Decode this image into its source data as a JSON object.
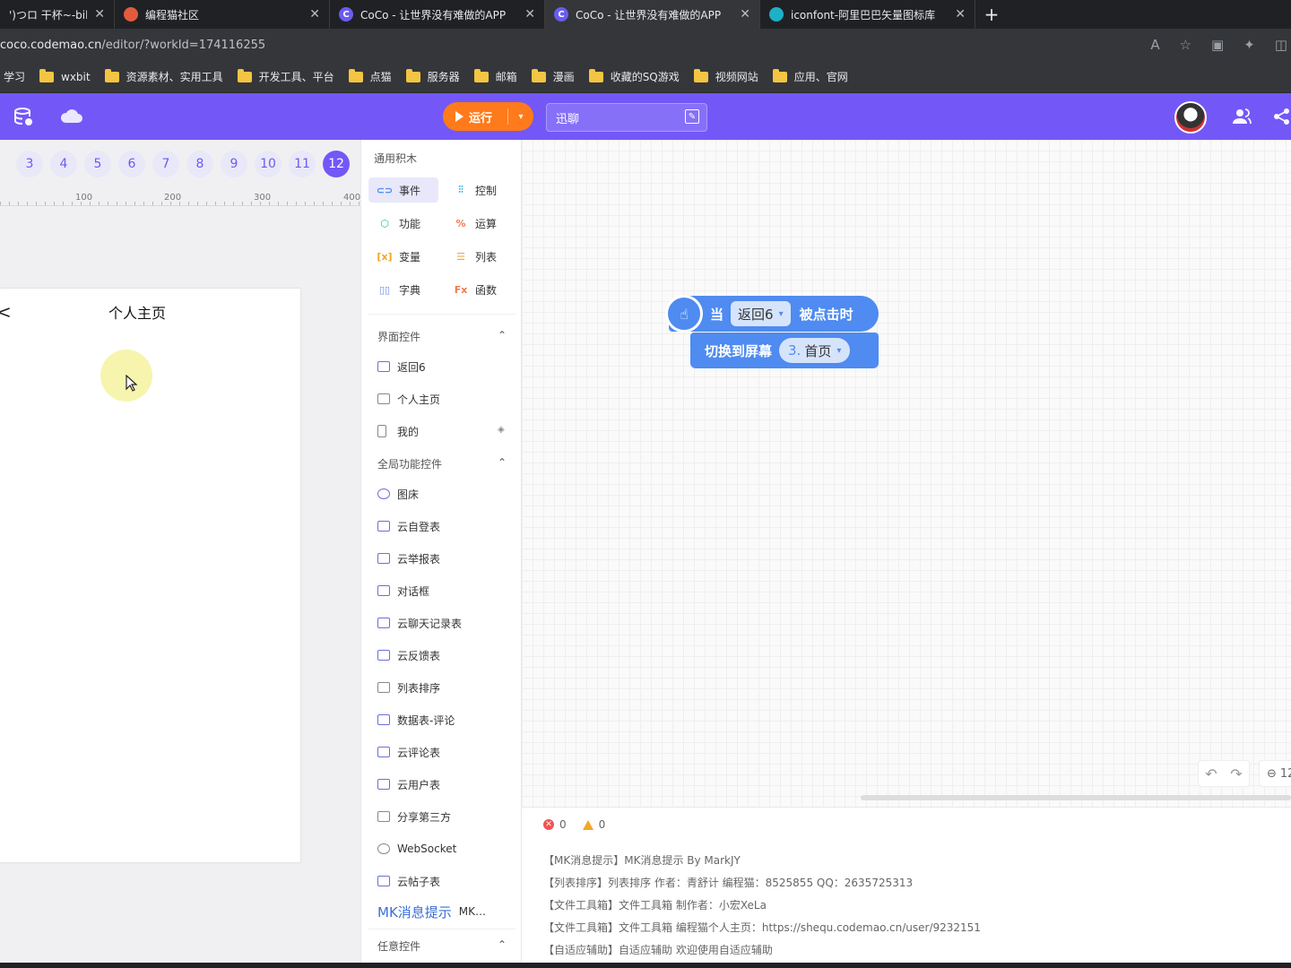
{
  "browser": {
    "tabs": [
      {
        "title": "')つロ 干杯~-bilib",
        "icon_color": "#fb7299",
        "active": false
      },
      {
        "title": "编程猫社区",
        "icon_color": "#e25b3c",
        "active": false
      },
      {
        "title": "CoCo - 让世界没有难做的APP",
        "icon_color": "#6a5cf0",
        "active": false
      },
      {
        "title": "CoCo - 让世界没有难做的APP",
        "icon_color": "#6a5cf0",
        "active": true
      },
      {
        "title": "iconfont-阿里巴巴矢量图标库",
        "icon_color": "#1db0c9",
        "active": false
      }
    ],
    "tab_close": "✕",
    "new_tab": "+",
    "url_host": "coco.codemao.cn",
    "url_path": "/editor/?workId=174116255",
    "bookmarks": [
      "学习",
      "wxbit",
      "资源素材、实用工具",
      "开发工具、平台",
      "点猫",
      "服务器",
      "邮箱",
      "漫画",
      "收藏的SQ游戏",
      "视频网站",
      "应用、官网"
    ]
  },
  "header": {
    "run_label": "运行",
    "project_name": "迅聊",
    "accent": "#7358f7",
    "run_color": "#ff7a1a"
  },
  "stage": {
    "pages": [
      "3",
      "4",
      "5",
      "6",
      "7",
      "8",
      "9",
      "10",
      "11",
      "12"
    ],
    "active_page": "12",
    "ruler_labels": [
      "100",
      "200",
      "300",
      "400"
    ],
    "screen_title": "个人主页",
    "back_glyph": "<"
  },
  "palette": {
    "title": "通用积木",
    "categories": [
      {
        "label": "事件",
        "icon": "event-icon",
        "color": "#4f8bf0"
      },
      {
        "label": "控制",
        "icon": "control-icon",
        "color": "#1aa3d9"
      },
      {
        "label": "功能",
        "icon": "function-icon",
        "color": "#28b8a4"
      },
      {
        "label": "运算",
        "icon": "operator-icon",
        "color": "#f07a4f"
      },
      {
        "label": "变量",
        "icon": "variable-icon",
        "color": "#f5a623"
      },
      {
        "label": "列表",
        "icon": "list-icon",
        "color": "#f5a623"
      },
      {
        "label": "字典",
        "icon": "dict-icon",
        "color": "#6a8cf0"
      },
      {
        "label": "函数",
        "icon": "fx-icon",
        "color": "#f07a4f"
      }
    ],
    "ui_section": "界面控件",
    "ui_items": [
      "返回6",
      "个人主页",
      "我的"
    ],
    "global_section": "全局功能控件",
    "global_items": [
      "图床",
      "云自登表",
      "云举报表",
      "对话框",
      "云聊天记录表",
      "云反馈表",
      "列表排序",
      "数据表-评论",
      "云评论表",
      "云用户表",
      "分享第三方",
      "WebSocket",
      "云帖子表"
    ],
    "broken_image_alt": "MK消息提示",
    "broken_image_label": "MK…",
    "any_section": "任意控件"
  },
  "workspace": {
    "hat_when": "当",
    "hat_dropdown": "返回6",
    "hat_clicked": "被点击时",
    "cmd_label": "切换到屏幕",
    "cmd_num": "3.",
    "cmd_screen": "首页",
    "zoom_text": "12"
  },
  "console": {
    "errors": "0",
    "warnings": "0",
    "logs": [
      "【MK消息提示】MK消息提示 By MarkJY",
      "【列表排序】列表排序 作者：青舒计 编程猫：8525855 QQ：2635725313",
      "【文件工具箱】文件工具箱 制作者：小宏XeLa",
      "【文件工具箱】文件工具箱 编程猫个人主页：https://shequ.codemao.cn/user/9232151",
      "【自适应辅助】自适应辅助 欢迎使用自适应辅助"
    ]
  }
}
